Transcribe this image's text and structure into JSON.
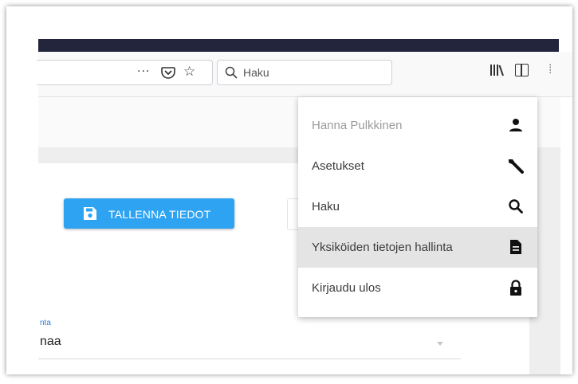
{
  "toolbar": {
    "overflow_glyph": "···",
    "bookmark_glyph": "☆",
    "search_placeholder": "Haku",
    "separator_glyph": "⁞"
  },
  "page": {
    "save_button_label": "TALLENNA TIEDOT",
    "field_label_partial": "nta",
    "field_value_partial": "naa"
  },
  "menu": {
    "items": [
      {
        "label": "Hanna Pulkkinen",
        "icon": "person-icon"
      },
      {
        "label": "Asetukset",
        "icon": "wrench-icon"
      },
      {
        "label": "Haku",
        "icon": "search-icon"
      },
      {
        "label": "Yksiköiden tietojen hallinta",
        "icon": "document-icon"
      },
      {
        "label": "Kirjaudu ulos",
        "icon": "lock-icon"
      }
    ],
    "highlighted_index": 3
  },
  "colors": {
    "accent": "#2ea3f2",
    "titlebar": "#23253d",
    "menu_highlight": "#e4e4e4"
  }
}
